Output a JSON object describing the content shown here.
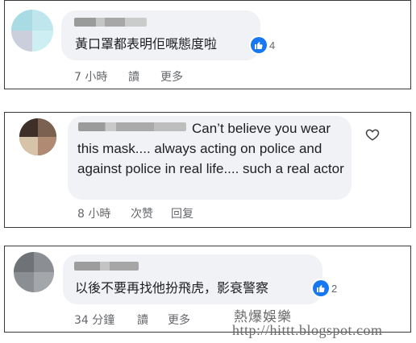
{
  "colors": {
    "like_blue": "#1877f2",
    "meta_gray": "#65676b",
    "bubble_bg": "#f0f2f5",
    "panel_border": "#3a3a3a"
  },
  "comments": [
    {
      "text": "黃口罩都表明佢嘅態度啦",
      "reaction_icon": "thumbs-up-icon",
      "reaction_count": "4",
      "time": "7 小時",
      "action_read": "讀",
      "action_more": "更多"
    },
    {
      "text": "Can’t believe you wear this mask.... always acting on police and against police in real life.... such a real actor",
      "time": "8 小時",
      "action_read": "次赞",
      "action_more": "回复",
      "side_icon": "heart-outline-icon"
    },
    {
      "text": "以後不要再找他扮飛虎，影衰警察",
      "reaction_icon": "thumbs-up-icon",
      "reaction_count": "2",
      "time": "34 分鐘",
      "action_read": "讀",
      "action_more": "更多"
    }
  ],
  "watermark": {
    "line1": "熱爆娛樂",
    "line2": "http://hittt.blogspot.com"
  }
}
